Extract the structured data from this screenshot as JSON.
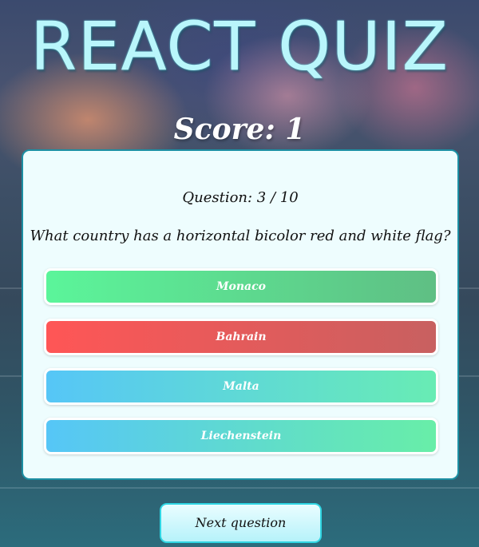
{
  "app": {
    "title": "REACT QUIZ",
    "score_text": "Score: 1"
  },
  "quiz": {
    "question_number_text": "Question: 3 / 10",
    "question_text": "What country has a horizontal bicolor red and white flag?",
    "answers": [
      {
        "label": "Monaco",
        "state": "correct"
      },
      {
        "label": "Bahrain",
        "state": "incorrect"
      },
      {
        "label": "Malta",
        "state": "neutral"
      },
      {
        "label": "Liechenstein",
        "state": "neutral"
      }
    ]
  },
  "controls": {
    "next_label": "Next question"
  },
  "colors": {
    "correct": "#5bf59a",
    "incorrect": "#ff5656",
    "neutral": "#56c6f7",
    "card_border": "#1c8fa3",
    "title": "#b9f6fb"
  }
}
